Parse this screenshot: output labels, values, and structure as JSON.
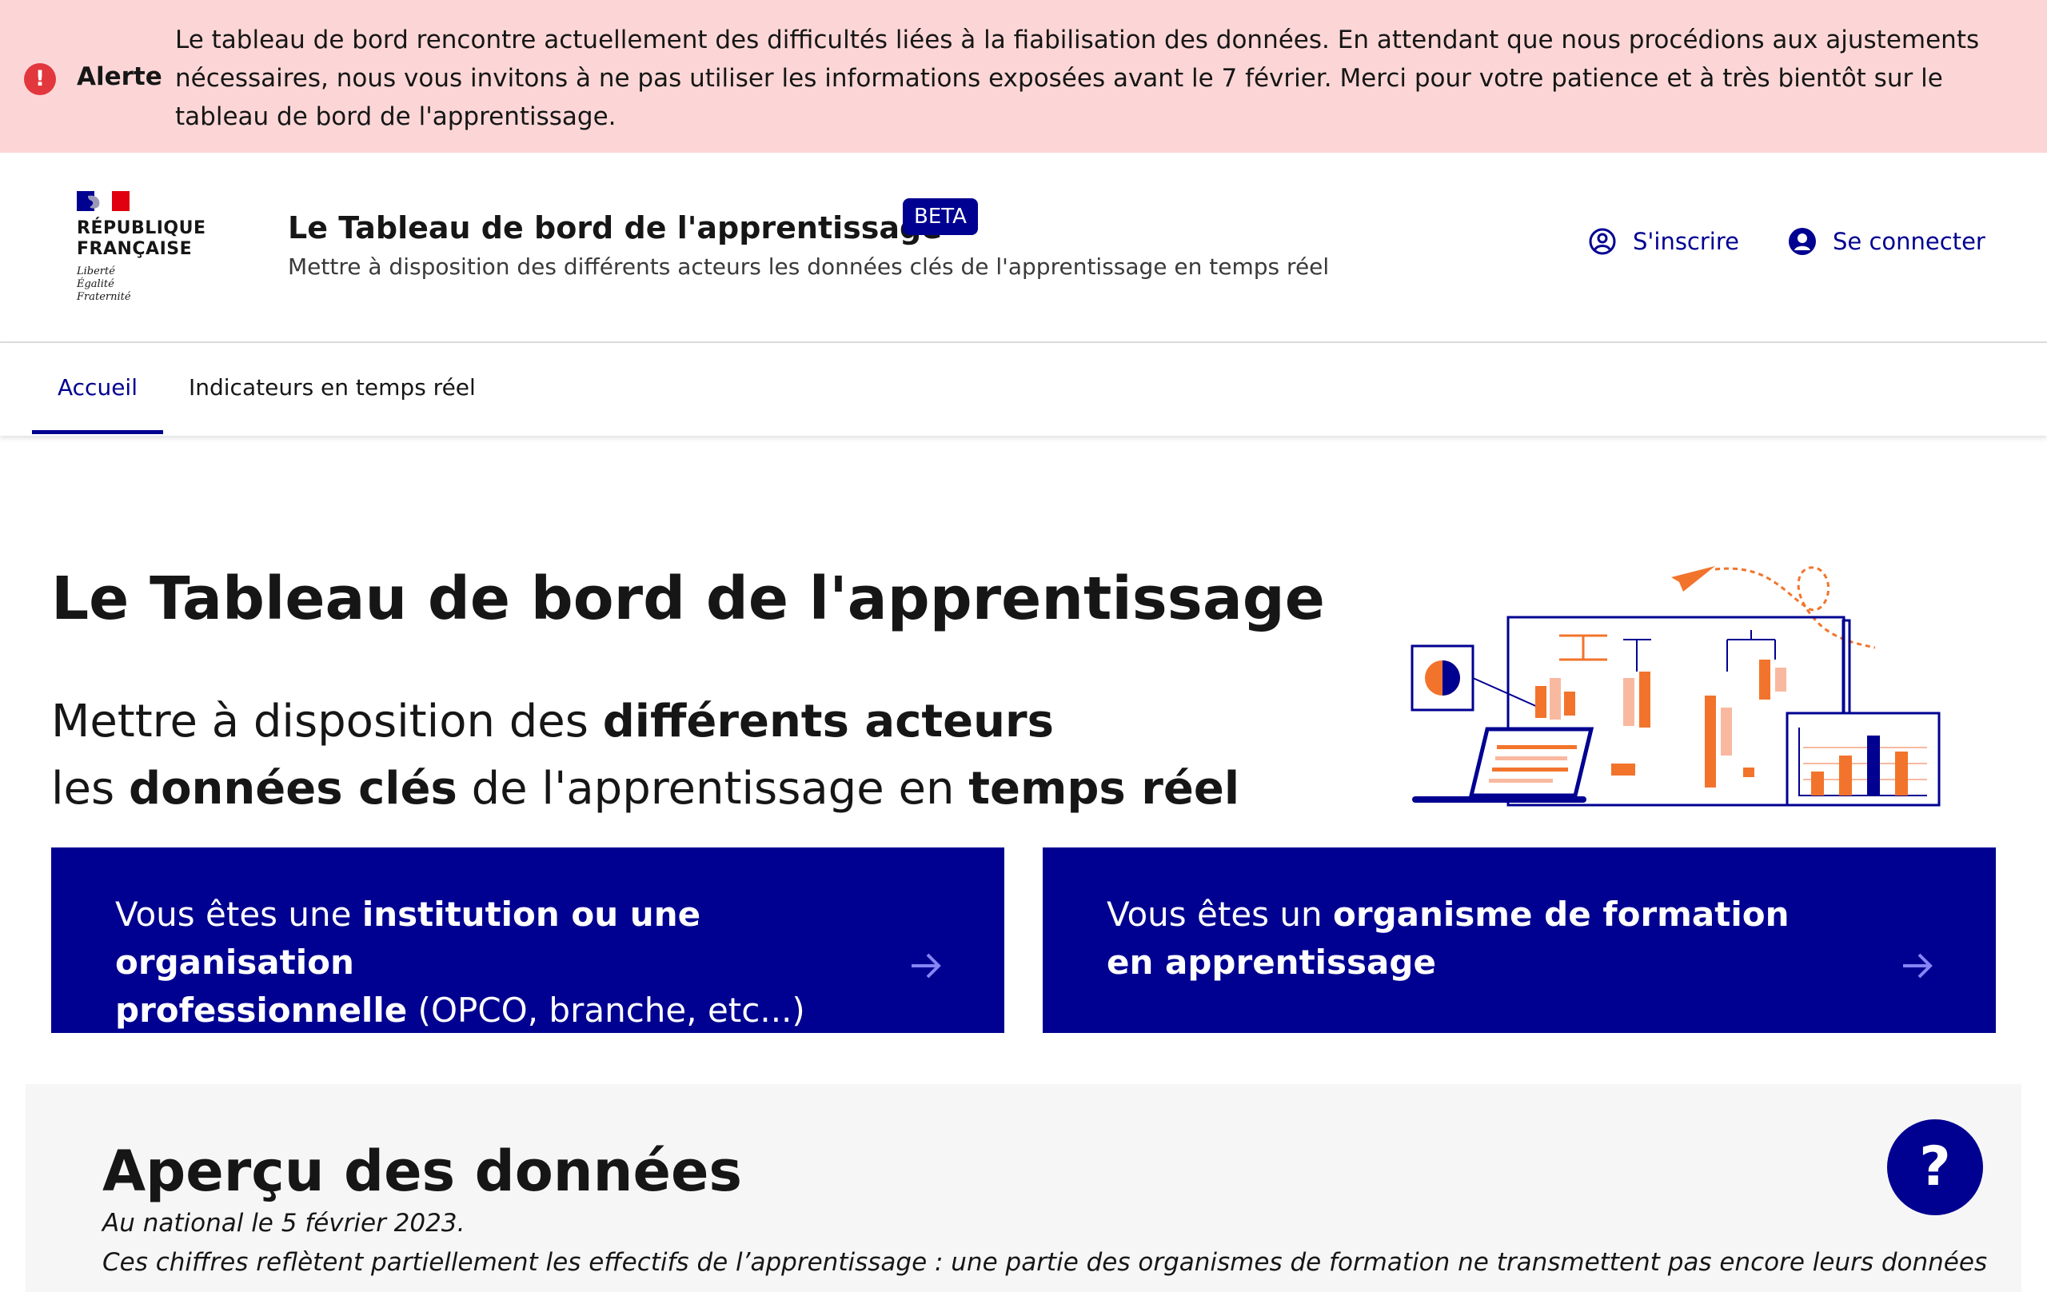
{
  "alert": {
    "title": "Alerte",
    "message": "Le tableau de bord rencontre actuellement des difficultés liées à la fiabilisation des données. En attendant que nous procédions aux ajustements nécessaires, nous vous invitons à ne pas utiliser les informations exposées avant le 7 février. Merci pour votre patience et à très bientôt sur le tableau de bord de l'apprentissage.",
    "icon": "exclamation-circle-icon",
    "color": "#e1373d",
    "background": "#fcd6d6"
  },
  "header": {
    "logo_lines": [
      "RÉPUBLIQUE",
      "FRANÇAISE"
    ],
    "devise": [
      "Liberté",
      "Égalité",
      "Fraternité"
    ],
    "title": "Le Tableau de bord de l'apprentissage",
    "badge": "BETA",
    "tagline": "Mettre à disposition des différents acteurs les données clés de l'apprentissage en temps réel",
    "register_label": "S'inscrire",
    "login_label": "Se connecter",
    "accent": "#000091"
  },
  "nav": {
    "items": [
      {
        "label": "Accueil",
        "active": true
      },
      {
        "label": "Indicateurs en temps réel",
        "active": false
      }
    ]
  },
  "hero": {
    "title": "Le Tableau de bord de l'apprentissage",
    "line1": {
      "a": "Mettre à disposition des ",
      "b": "différents acteurs"
    },
    "line2": {
      "a": "les ",
      "b": "données clés",
      "c": " de l'apprentissage en ",
      "d": "temps réel"
    }
  },
  "cards": [
    {
      "pre": "Vous êtes une ",
      "bold1": "institution ou une organisation",
      "bold2": "professionnelle",
      "post": " (OPCO, branche, etc...)"
    },
    {
      "pre": "Vous êtes un ",
      "bold1": "organisme de formation",
      "bold2": "en apprentissage",
      "post": ""
    }
  ],
  "data_section": {
    "title": "Aperçu des données",
    "date": "Au national le 5 février 2023.",
    "note": "Ces chiffres reflètent partiellement les effectifs de l’apprentissage : une partie des organismes de formation ne transmettent pas encore leurs données"
  },
  "help": {
    "label": "?"
  }
}
